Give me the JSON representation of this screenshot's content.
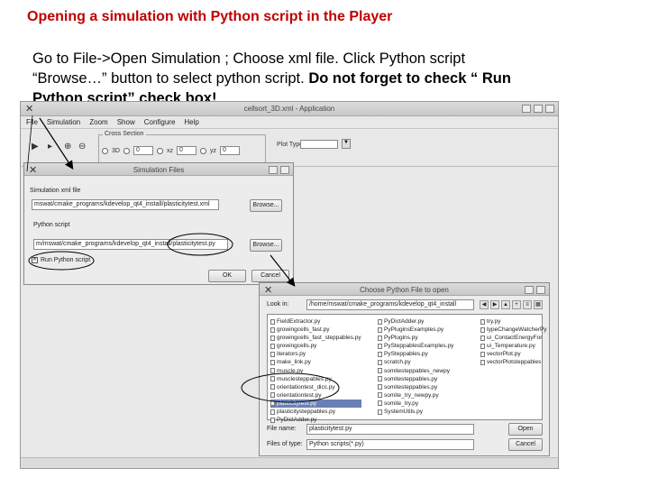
{
  "slide": {
    "title": "Opening a simulation with Python script in the Player",
    "line1": "Go to File->Open Simulation ; Choose xml file. Click Python script",
    "line2_plain": "“Browse…” button to select python script. ",
    "line2_bold": "Do not forget to check “ Run",
    "line3_bold": "Python script” check box!"
  },
  "app": {
    "window_title": "cellsort_3D.xml - Application",
    "menu": [
      "File",
      "Simulation",
      "Zoom",
      "Show",
      "Configure",
      "Help"
    ],
    "cross_section": {
      "legend": "Cross Section",
      "opt_3d": "3D",
      "val1": "0",
      "opt_xz": "xz",
      "val2": "0",
      "opt_yz": "yz",
      "val3": "0"
    },
    "plot_type_label": "Plot Type"
  },
  "sim_dialog": {
    "title": "Simulation Files",
    "xml_label": "Simulation xml file",
    "xml_value": "mswat/cmake_programs/kdevelop_qt4_install/plasticitytest.xml",
    "browse1": "Browse...",
    "python_label": "Python script",
    "python_value": "m/mswat/cmake_programs/kdevelop_qt4_install/plasticitytest.py",
    "browse2": "Browse...",
    "run_python_label": "Run Python script",
    "ok": "OK",
    "cancel": "Cancel"
  },
  "file_dialog": {
    "title": "Choose Python File to open",
    "look_in_label": "Look in:",
    "look_in_value": "/home/mswat/cmake_programs/kdevelop_qt4_install",
    "col1": [
      "FieldExtractor.py",
      "growingcells_fast.py",
      "growingcells_fast_steppables.py",
      "growingcells.py",
      "iterators.py",
      "make_link.py",
      "muscle.py",
      "musclesteppables.py",
      "orientationtest_dicc.py",
      "orientationtest.py",
      "plasticitytest.py",
      "plasticitysteppables.py",
      "PyDictAdder.py"
    ],
    "col2": [
      "PyDictAdder.py",
      "PyPluginsExamples.py",
      "PyPlugins.py",
      "PySteppablesExamples.py",
      "PySteppables.py",
      "scratch.py",
      "somitesteppables_newpy",
      "somitesteppables.py",
      "somitesteppables.py",
      "somite_try_newpy.py",
      "somite_try.py",
      "SystemUtils.py"
    ],
    "col3": [
      "try.py",
      "typeChangeWatcherPy",
      "ui_ContactEnergyFor",
      "ui_Temperature.py",
      "vectorPlot.py",
      "vectorPlotsteppables"
    ],
    "selected": "plasticitytest.py",
    "filename_label": "File name:",
    "filename_value": "plasticitytest.py",
    "filetype_label": "Files of type:",
    "filetype_value": "Python scripts(*.py)",
    "open": "Open",
    "cancel": "Cancel"
  }
}
